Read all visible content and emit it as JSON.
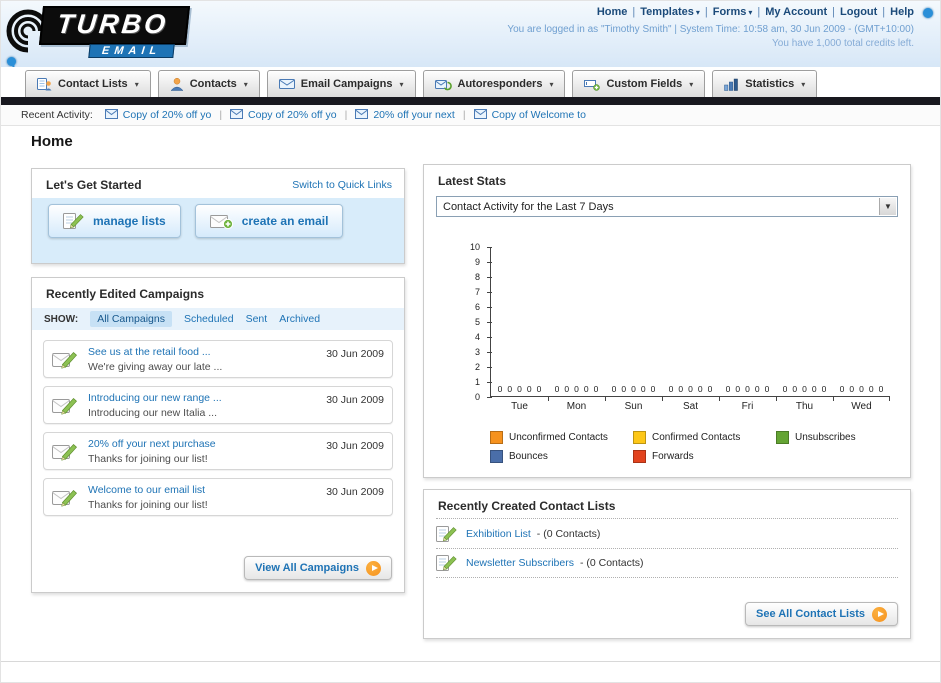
{
  "colors": {
    "accent_orange": "#f6921e",
    "link_blue": "#1e73b5",
    "brand_navy": "#1b4a7a",
    "dark_bar": "#18181f",
    "panel_blue_bg": "#d8ecfa"
  },
  "icons": {
    "dropdown_arrow": "▾",
    "select_arrow": "▼"
  },
  "header": {
    "logo_title": "TURBO",
    "logo_subtitle": "EMAIL",
    "nav_links": [
      {
        "label": "Home",
        "dropdown": false
      },
      {
        "label": "Templates",
        "dropdown": true
      },
      {
        "label": "Forms",
        "dropdown": true
      },
      {
        "label": "My Account",
        "dropdown": false
      },
      {
        "label": "Logout",
        "dropdown": false
      },
      {
        "label": "Help",
        "dropdown": false
      }
    ],
    "login_status": "You are logged in as \"Timothy Smith\" | System Time: 10:58 am, 30 Jun 2009 - (GMT+10:00)",
    "credits": "You have 1,000 total credits left."
  },
  "nav_tabs": [
    {
      "label": "Contact Lists",
      "icon": "contact-lists-icon"
    },
    {
      "label": "Contacts",
      "icon": "contacts-icon"
    },
    {
      "label": "Email Campaigns",
      "icon": "email-campaigns-icon"
    },
    {
      "label": "Autoresponders",
      "icon": "autoresponders-icon"
    },
    {
      "label": "Custom Fields",
      "icon": "custom-fields-icon"
    },
    {
      "label": "Statistics",
      "icon": "statistics-icon"
    }
  ],
  "recent_activity": {
    "label": "Recent Activity:",
    "items": [
      "Copy of 20% off yo",
      "Copy of 20% off yo",
      "20% off your next",
      "Copy of Welcome to"
    ]
  },
  "page_title": "Home",
  "get_started": {
    "title": "Let's Get Started",
    "switch_link": "Switch to Quick Links",
    "buttons": [
      {
        "label": "manage lists"
      },
      {
        "label": "create an email"
      }
    ]
  },
  "campaigns": {
    "title": "Recently Edited Campaigns",
    "show_label": "SHOW:",
    "filters": [
      "All Campaigns",
      "Scheduled",
      "Sent",
      "Archived"
    ],
    "active_filter": "All Campaigns",
    "items": [
      {
        "title": "See us at the retail food ...",
        "subtitle": "We're giving away our late ...",
        "date": "30 Jun 2009"
      },
      {
        "title": "Introducing our new range ...",
        "subtitle": "Introducing our new Italia ...",
        "date": "30 Jun 2009"
      },
      {
        "title": "20% off your next purchase",
        "subtitle": "Thanks for joining our list!",
        "date": "30 Jun 2009"
      },
      {
        "title": "Welcome to our email list",
        "subtitle": "Thanks for joining our list!",
        "date": "30 Jun 2009"
      }
    ],
    "view_all_label": "View All Campaigns"
  },
  "stats": {
    "title": "Latest Stats",
    "period_selected": "Contact Activity for the Last 7 Days"
  },
  "chart_data": {
    "type": "bar",
    "title": "Contact Activity for the Last 7 Days",
    "categories": [
      "Tue",
      "Mon",
      "Sun",
      "Sat",
      "Fri",
      "Thu",
      "Wed"
    ],
    "series": [
      {
        "name": "Unconfirmed Contacts",
        "color": "#f6921e",
        "values": [
          0,
          0,
          0,
          0,
          0,
          0,
          0
        ]
      },
      {
        "name": "Confirmed Contacts",
        "color": "#fdc718",
        "values": [
          0,
          0,
          0,
          0,
          0,
          0,
          0
        ]
      },
      {
        "name": "Unsubscribes",
        "color": "#64a433",
        "values": [
          0,
          0,
          0,
          0,
          0,
          0,
          0
        ]
      },
      {
        "name": "Bounces",
        "color": "#4a6ea9",
        "values": [
          0,
          0,
          0,
          0,
          0,
          0,
          0
        ]
      },
      {
        "name": "Forwards",
        "color": "#e2431e",
        "values": [
          0,
          0,
          0,
          0,
          0,
          0,
          0
        ]
      }
    ],
    "ylim": [
      0,
      10
    ],
    "yticks": [
      0,
      1,
      2,
      3,
      4,
      5,
      6,
      7,
      8,
      9,
      10
    ],
    "xlabel": "",
    "ylabel": "",
    "grid": false,
    "legend_position": "bottom"
  },
  "contact_lists": {
    "title": "Recently Created Contact Lists",
    "items": [
      {
        "name": "Exhibition List",
        "detail": "- (0 Contacts)"
      },
      {
        "name": "Newsletter Subscribers",
        "detail": "- (0 Contacts)"
      }
    ],
    "see_all_label": "See All Contact Lists"
  }
}
